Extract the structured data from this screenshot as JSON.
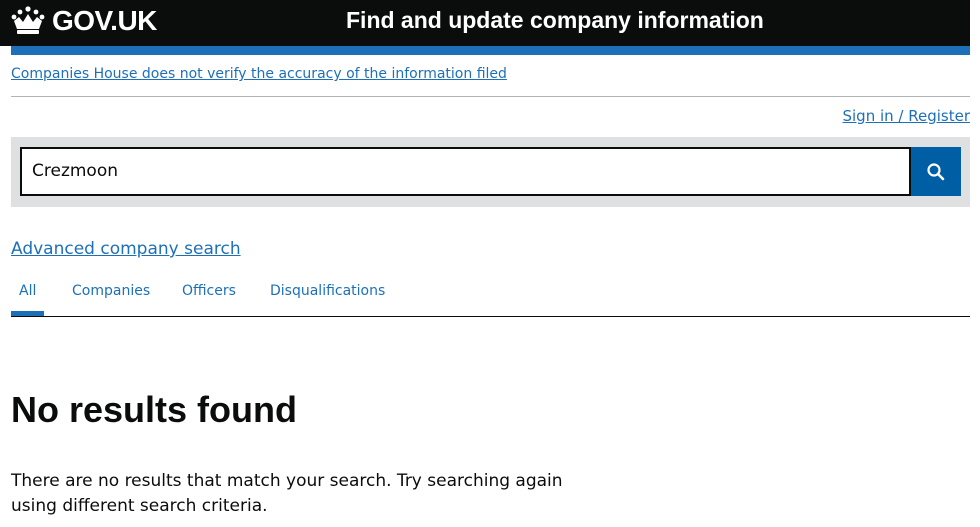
{
  "header": {
    "logo_text": "GOV.UK",
    "service_name": "Find and update company information"
  },
  "notice": {
    "text": "Companies House does not verify the accuracy of the information filed"
  },
  "account": {
    "signin_label": "Sign in / Register"
  },
  "search": {
    "value": "Crezmoon",
    "button_icon": "search-icon"
  },
  "advanced_search_label": "Advanced company search",
  "tabs": [
    {
      "label": "All",
      "active": true
    },
    {
      "label": "Companies",
      "active": false
    },
    {
      "label": "Officers",
      "active": false
    },
    {
      "label": "Disqualifications",
      "active": false
    }
  ],
  "results": {
    "heading": "No results found",
    "message": "There are no results that match your search. Try searching again using different search criteria."
  },
  "colors": {
    "header_bg": "#0b0c0c",
    "brand_blue": "#1d70b8",
    "search_button": "#005ea5",
    "search_panel": "#dee0e2"
  }
}
